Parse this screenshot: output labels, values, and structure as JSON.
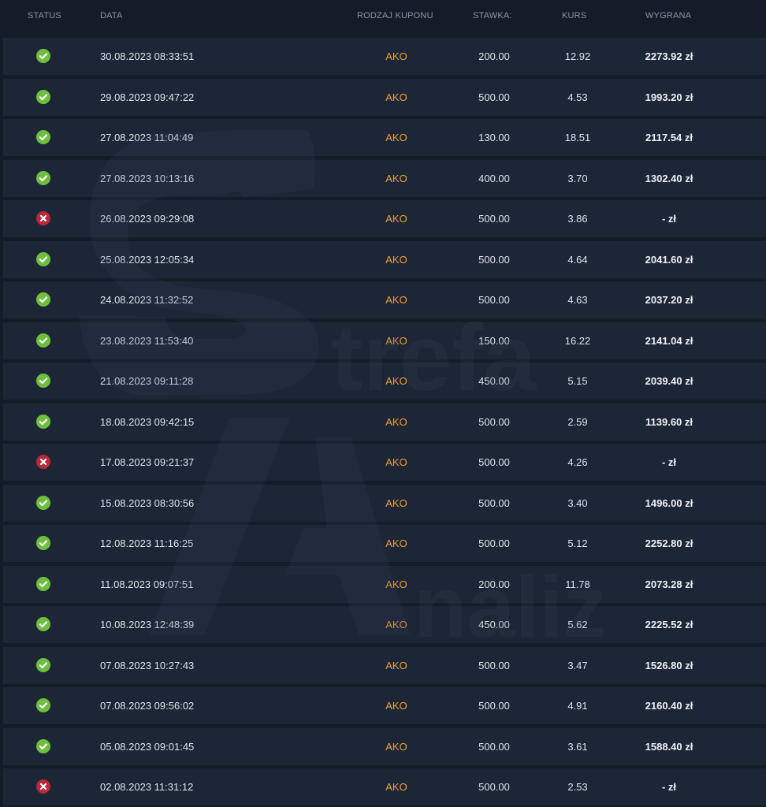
{
  "table": {
    "headers": {
      "status": "STATUS",
      "date": "DATA",
      "coupon_type": "RODZAJ KUPONU",
      "stake": "STAWKA:",
      "odds": "KURS",
      "win": "WYGRANA"
    },
    "colors": {
      "won": "#6fbf3f",
      "lost": "#b8293a",
      "coupon_type": "#f0a030",
      "row_bg": "#1d2637",
      "page_bg": "#151c29"
    },
    "rows": [
      {
        "status": "won",
        "date": "30.08.2023 08:33:51",
        "type": "AKO",
        "stake": "200.00",
        "odds": "12.92",
        "win": "2273.92 zł"
      },
      {
        "status": "won",
        "date": "29.08.2023 09:47:22",
        "type": "AKO",
        "stake": "500.00",
        "odds": "4.53",
        "win": "1993.20 zł"
      },
      {
        "status": "won",
        "date": "27.08.2023 11:04:49",
        "type": "AKO",
        "stake": "130.00",
        "odds": "18.51",
        "win": "2117.54 zł"
      },
      {
        "status": "won",
        "date": "27.08.2023 10:13:16",
        "type": "AKO",
        "stake": "400.00",
        "odds": "3.70",
        "win": "1302.40 zł"
      },
      {
        "status": "lost",
        "date": "26.08.2023 09:29:08",
        "type": "AKO",
        "stake": "500.00",
        "odds": "3.86",
        "win": "- zł"
      },
      {
        "status": "won",
        "date": "25.08.2023 12:05:34",
        "type": "AKO",
        "stake": "500.00",
        "odds": "4.64",
        "win": "2041.60 zł"
      },
      {
        "status": "won",
        "date": "24.08.2023 11:32:52",
        "type": "AKO",
        "stake": "500.00",
        "odds": "4.63",
        "win": "2037.20 zł"
      },
      {
        "status": "won",
        "date": "23.08.2023 11:53:40",
        "type": "AKO",
        "stake": "150.00",
        "odds": "16.22",
        "win": "2141.04 zł"
      },
      {
        "status": "won",
        "date": "21.08.2023 09:11:28",
        "type": "AKO",
        "stake": "450.00",
        "odds": "5.15",
        "win": "2039.40 zł"
      },
      {
        "status": "won",
        "date": "18.08.2023 09:42:15",
        "type": "AKO",
        "stake": "500.00",
        "odds": "2.59",
        "win": "1139.60 zł"
      },
      {
        "status": "lost",
        "date": "17.08.2023 09:21:37",
        "type": "AKO",
        "stake": "500.00",
        "odds": "4.26",
        "win": "- zł"
      },
      {
        "status": "won",
        "date": "15.08.2023 08:30:56",
        "type": "AKO",
        "stake": "500.00",
        "odds": "3.40",
        "win": "1496.00 zł"
      },
      {
        "status": "won",
        "date": "12.08.2023 11:16:25",
        "type": "AKO",
        "stake": "500.00",
        "odds": "5.12",
        "win": "2252.80 zł"
      },
      {
        "status": "won",
        "date": "11.08.2023 09:07:51",
        "type": "AKO",
        "stake": "200.00",
        "odds": "11.78",
        "win": "2073.28 zł"
      },
      {
        "status": "won",
        "date": "10.08.2023 12:48:39",
        "type": "AKO",
        "stake": "450.00",
        "odds": "5.62",
        "win": "2225.52 zł"
      },
      {
        "status": "won",
        "date": "07.08.2023 10:27:43",
        "type": "AKO",
        "stake": "500.00",
        "odds": "3.47",
        "win": "1526.80 zł"
      },
      {
        "status": "won",
        "date": "07.08.2023 09:56:02",
        "type": "AKO",
        "stake": "500.00",
        "odds": "4.91",
        "win": "2160.40 zł"
      },
      {
        "status": "won",
        "date": "05.08.2023 09:01:45",
        "type": "AKO",
        "stake": "500.00",
        "odds": "3.61",
        "win": "1588.40 zł"
      },
      {
        "status": "lost",
        "date": "02.08.2023 11:31:12",
        "type": "AKO",
        "stake": "500.00",
        "odds": "2.53",
        "win": "- zł"
      }
    ]
  },
  "watermark": {
    "text_1": "trefa",
    "text_2": "naliz",
    "icon": "strefa-analiz-logo-watermark"
  }
}
